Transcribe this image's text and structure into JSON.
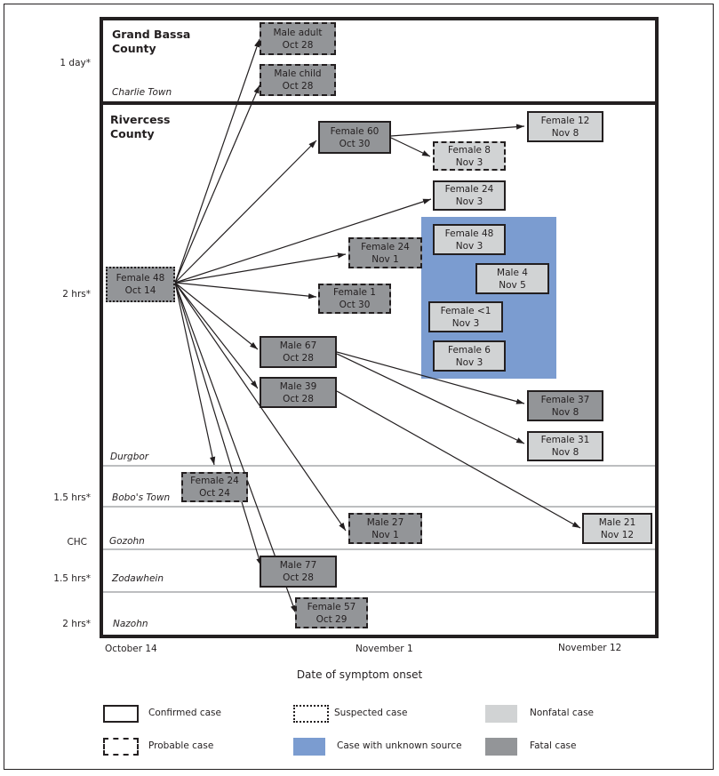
{
  "counties": [
    {
      "name_line1": "Grand Bassa",
      "name_line2": "County"
    },
    {
      "name_line1": "Rivercess",
      "name_line2": "County"
    }
  ],
  "towns": [
    "Charlie Town",
    "Durgbor",
    "Bobo's Town",
    "Gozohn",
    "Zodawhein",
    "Nazohn"
  ],
  "travel_times": [
    "1 day*",
    "2 hrs*",
    "1.5 hrs*",
    "CHC",
    "1.5 hrs*",
    "2 hrs*"
  ],
  "cases": [
    {
      "id": "F48_Oct14",
      "label": "Female 48",
      "date": "Oct 14",
      "classification": "suspected",
      "outcome": "fatal"
    },
    {
      "id": "Madult",
      "label": "Male adult",
      "date": "Oct 28",
      "classification": "probable",
      "outcome": "fatal"
    },
    {
      "id": "Mchild",
      "label": "Male child",
      "date": "Oct 28",
      "classification": "probable",
      "outcome": "fatal"
    },
    {
      "id": "F60",
      "label": "Female 60",
      "date": "Oct 30",
      "classification": "confirmed",
      "outcome": "fatal"
    },
    {
      "id": "F12",
      "label": "Female 12",
      "date": "Nov 8",
      "classification": "confirmed",
      "outcome": "nonfatal"
    },
    {
      "id": "F8",
      "label": "Female 8",
      "date": "Nov 3",
      "classification": "probable",
      "outcome": "nonfatal"
    },
    {
      "id": "F24_Nov3",
      "label": "Female 24",
      "date": "Nov 3",
      "classification": "confirmed",
      "outcome": "nonfatal"
    },
    {
      "id": "F48_Nov3",
      "label": "Female 48",
      "date": "Nov 3",
      "classification": "confirmed",
      "outcome": "nonfatal",
      "unknown_source": true
    },
    {
      "id": "M4",
      "label": "Male 4",
      "date": "Nov 5",
      "classification": "confirmed",
      "outcome": "nonfatal",
      "unknown_source": true
    },
    {
      "id": "Flt1",
      "label": "Female <1",
      "date": "Nov 3",
      "classification": "confirmed",
      "outcome": "nonfatal",
      "unknown_source": true
    },
    {
      "id": "F6",
      "label": "Female 6",
      "date": "Nov 3",
      "classification": "confirmed",
      "outcome": "nonfatal",
      "unknown_source": true
    },
    {
      "id": "F24_Nov1",
      "label": "Female 24",
      "date": "Nov 1",
      "classification": "probable",
      "outcome": "fatal"
    },
    {
      "id": "F1",
      "label": "Female 1",
      "date": "Oct 30",
      "classification": "probable",
      "outcome": "fatal"
    },
    {
      "id": "M67",
      "label": "Male 67",
      "date": "Oct 28",
      "classification": "confirmed",
      "outcome": "fatal"
    },
    {
      "id": "M39",
      "label": "Male 39",
      "date": "Oct 28",
      "classification": "confirmed",
      "outcome": "fatal"
    },
    {
      "id": "F37",
      "label": "Female 37",
      "date": "Nov 8",
      "classification": "confirmed",
      "outcome": "fatal"
    },
    {
      "id": "F31",
      "label": "Female 31",
      "date": "Nov 8",
      "classification": "confirmed",
      "outcome": "nonfatal"
    },
    {
      "id": "F24_Oct24",
      "label": "Female 24",
      "date": "Oct 24",
      "classification": "probable",
      "outcome": "fatal"
    },
    {
      "id": "M27",
      "label": "Male 27",
      "date": "Nov 1",
      "classification": "probable",
      "outcome": "fatal"
    },
    {
      "id": "M21",
      "label": "Male 21",
      "date": "Nov 12",
      "classification": "confirmed",
      "outcome": "nonfatal"
    },
    {
      "id": "M77",
      "label": "Male 77",
      "date": "Oct 28",
      "classification": "confirmed",
      "outcome": "fatal"
    },
    {
      "id": "F57",
      "label": "Female 57",
      "date": "Oct 29",
      "classification": "probable",
      "outcome": "fatal"
    }
  ],
  "transmissions": [
    [
      "F48_Oct14",
      "Madult"
    ],
    [
      "F48_Oct14",
      "Mchild"
    ],
    [
      "F48_Oct14",
      "F60"
    ],
    [
      "F48_Oct14",
      "F24_Nov3"
    ],
    [
      "F48_Oct14",
      "F24_Nov1"
    ],
    [
      "F48_Oct14",
      "F1"
    ],
    [
      "F48_Oct14",
      "M67"
    ],
    [
      "F48_Oct14",
      "M39"
    ],
    [
      "F48_Oct14",
      "F24_Oct24"
    ],
    [
      "F48_Oct14",
      "M27"
    ],
    [
      "F48_Oct14",
      "M77"
    ],
    [
      "F48_Oct14",
      "F57"
    ],
    [
      "F60",
      "F12"
    ],
    [
      "F60",
      "F8"
    ],
    [
      "M67",
      "F37"
    ],
    [
      "M67",
      "F31"
    ],
    [
      "M39",
      "M21"
    ]
  ],
  "x_axis": {
    "ticks": [
      "October 14",
      "November 1",
      "November 12"
    ],
    "title": "Date of symptom onset"
  },
  "legend": {
    "confirmed": "Confirmed case",
    "probable": "Probable case",
    "suspected": "Suspected case",
    "unknown_source": "Case with unknown source",
    "nonfatal": "Nonfatal case",
    "fatal": "Fatal case"
  },
  "colors": {
    "fatal": "#939598",
    "nonfatal": "#d1d3d4",
    "unknown_source": "#7b9cd0",
    "line": "#231f20"
  }
}
